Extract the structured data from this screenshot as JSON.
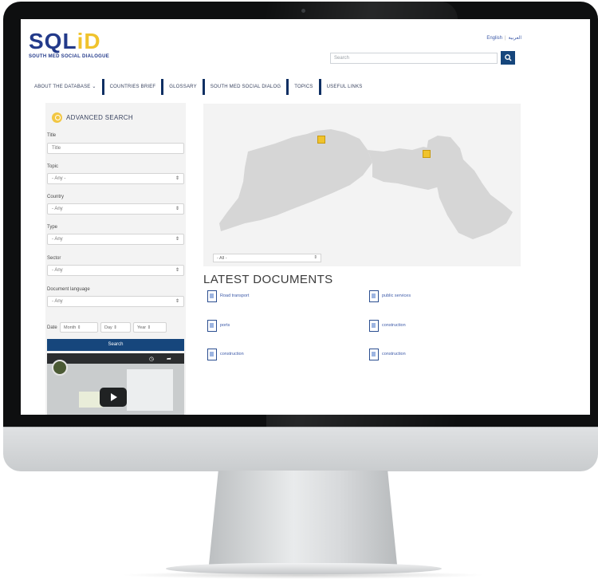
{
  "site": {
    "logo_text_a": "SQL",
    "logo_text_b": "iD",
    "logo_subtitle": "SOUTH MED SOCIAL DIALOGUE",
    "languages": [
      "English",
      "العربية"
    ],
    "search_placeholder": "Search",
    "search_icon": "magnifier-icon"
  },
  "nav": {
    "items": [
      "ABOUT THE DATABASE ⌄",
      "COUNTRIES BRIEF",
      "GLOSSARY",
      "SOUTH MED SOCIAL DIALOG",
      "TOPICS",
      "USEFUL LINKS"
    ]
  },
  "advanced_search": {
    "title": "ADVANCED SEARCH",
    "title_label": "Title",
    "title_placeholder": "Title",
    "topic_label": "Topic",
    "topic_value": "- Any -",
    "country_label": "Country",
    "country_value": "- Any",
    "type_label": "Type",
    "type_value": "- Any",
    "sector_label": "Sector",
    "sector_value": "- Any",
    "doc_lang_label": "Document language",
    "doc_lang_value": "- Any",
    "date_label": "Date",
    "date_month": "Month",
    "date_day": "Day",
    "date_year": "Year",
    "submit_label": "Search"
  },
  "map": {
    "select_value": "- All -",
    "country_color": "#d6d6d6",
    "marker_color": "#f0c32c",
    "marker_icon": "document-marker-icon"
  },
  "latest": {
    "title": "LATEST DOCUMENTS",
    "documents": [
      "Road transport",
      "public services",
      "ports",
      "construction",
      "construction",
      "construction"
    ]
  }
}
